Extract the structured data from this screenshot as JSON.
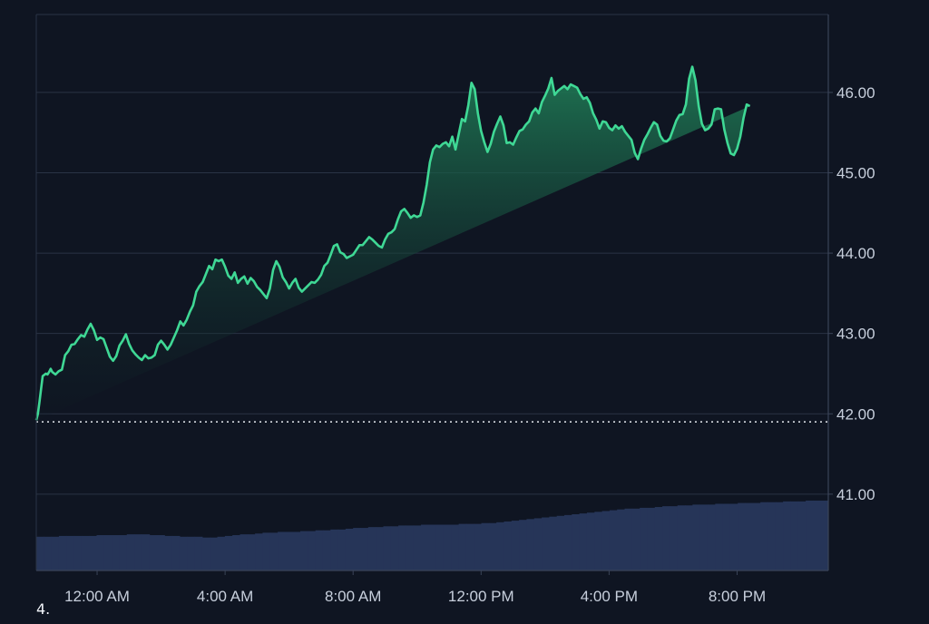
{
  "chart_data": {
    "type": "area",
    "ylim": [
      40.05,
      46.97
    ],
    "yticks": [
      "41.00",
      "42.00",
      "43.00",
      "44.00",
      "45.00",
      "46.00"
    ],
    "ytick_values": [
      41,
      42,
      43,
      44,
      45,
      46
    ],
    "xticks": [
      "12:00 AM",
      "4:00 AM",
      "8:00 AM",
      "12:00 PM",
      "4:00 PM",
      "8:00 PM"
    ],
    "xtick_hours": [
      0,
      4,
      8,
      12,
      16,
      20
    ],
    "xlim_hours": [
      -1.9,
      22.85
    ],
    "reference_line": 41.9,
    "grid": true,
    "colors": {
      "background": "#0f1522",
      "line": "#3fd895",
      "area_top": "#1f7a55",
      "area_bottom": "#0e1a22",
      "volume": "#263558",
      "grid": "#2a3345",
      "axis_text": "#c7cfdc",
      "reference": "#e6eaf0"
    },
    "price_series": {
      "hours": [
        -1.9,
        -1.85,
        -1.8,
        -1.7,
        -1.6,
        -1.55,
        -1.5,
        -1.45,
        -1.4,
        -1.3,
        -1.2,
        -1.1,
        -1.0,
        -0.9,
        -0.8,
        -0.7,
        -0.6,
        -0.5,
        -0.4,
        -0.3,
        -0.2,
        -0.1,
        0.0,
        0.1,
        0.2,
        0.3,
        0.4,
        0.5,
        0.6,
        0.7,
        0.8,
        0.9,
        1.0,
        1.1,
        1.2,
        1.3,
        1.4,
        1.5,
        1.6,
        1.7,
        1.8,
        1.9,
        2.0,
        2.1,
        2.2,
        2.3,
        2.4,
        2.5,
        2.6,
        2.7,
        2.8,
        2.9,
        3.0,
        3.1,
        3.2,
        3.3,
        3.4,
        3.5,
        3.6,
        3.7,
        3.8,
        3.9,
        4.0,
        4.1,
        4.2,
        4.3,
        4.4,
        4.5,
        4.6,
        4.7,
        4.8,
        4.9,
        5.0,
        5.1,
        5.2,
        5.3,
        5.4,
        5.5,
        5.6,
        5.7,
        5.8,
        5.9,
        6.0,
        6.1,
        6.2,
        6.3,
        6.4,
        6.5,
        6.6,
        6.7,
        6.8,
        6.9,
        7.0,
        7.1,
        7.2,
        7.3,
        7.4,
        7.5,
        7.6,
        7.7,
        7.8,
        7.9,
        8.0,
        8.1,
        8.2,
        8.3,
        8.4,
        8.5,
        8.6,
        8.7,
        8.8,
        8.9,
        9.0,
        9.1,
        9.2,
        9.3,
        9.4,
        9.5,
        9.6,
        9.7,
        9.8,
        9.9,
        10.0,
        10.1,
        10.2,
        10.3,
        10.4,
        10.5,
        10.6,
        10.7,
        10.8,
        10.9,
        11.0,
        11.1,
        11.2,
        11.3,
        11.4,
        11.5,
        11.6,
        11.7,
        11.8,
        11.9,
        12.0,
        12.1,
        12.2,
        12.3,
        12.4,
        12.5,
        12.6,
        12.7,
        12.8,
        12.9,
        13.0,
        13.1,
        13.2,
        13.3,
        13.4,
        13.5,
        13.6,
        13.7,
        13.8,
        13.9,
        14.0,
        14.1,
        14.2,
        14.3,
        14.4,
        14.5,
        14.6,
        14.7,
        14.8,
        14.9,
        15.0,
        15.1,
        15.2,
        15.3,
        15.4,
        15.5,
        15.6,
        15.7,
        15.8,
        15.9,
        16.0,
        16.1,
        16.2,
        16.3,
        16.4,
        16.5,
        16.6,
        16.7,
        16.8,
        16.9,
        17.0,
        17.1,
        17.2,
        17.3,
        17.4,
        17.5,
        17.6,
        17.7,
        17.8,
        17.9,
        18.0,
        18.1,
        18.2,
        18.3,
        18.4,
        18.5,
        18.6,
        18.7,
        18.8,
        18.9,
        19.0,
        19.1,
        19.2,
        19.3,
        19.4,
        19.5,
        19.6,
        19.7,
        19.8,
        19.9,
        20.0,
        20.1,
        20.2,
        20.3,
        20.4,
        20.5,
        20.6,
        20.7,
        20.8,
        20.9,
        21.0,
        21.1,
        21.2,
        21.3,
        21.4,
        21.5,
        21.6,
        21.7,
        21.8,
        21.9,
        22.0,
        22.1,
        22.2,
        22.3,
        22.4,
        22.5,
        22.6,
        22.7,
        22.8,
        22.85
      ],
      "values": [
        41.92,
        42.0,
        42.15,
        42.47,
        42.5,
        42.49,
        42.52,
        42.56,
        42.52,
        42.49,
        42.53,
        42.55,
        42.73,
        42.78,
        42.86,
        42.87,
        42.93,
        42.98,
        42.96,
        43.05,
        43.12,
        43.04,
        42.92,
        42.95,
        42.93,
        42.82,
        42.71,
        42.66,
        42.72,
        42.85,
        42.91,
        42.99,
        42.87,
        42.79,
        42.74,
        42.7,
        42.67,
        42.73,
        42.69,
        42.7,
        42.73,
        42.86,
        42.91,
        42.86,
        42.8,
        42.86,
        42.95,
        43.04,
        43.15,
        43.1,
        43.17,
        43.27,
        43.35,
        43.52,
        43.59,
        43.64,
        43.74,
        43.84,
        43.8,
        43.92,
        43.9,
        43.92,
        43.83,
        43.72,
        43.68,
        43.76,
        43.63,
        43.68,
        43.71,
        43.62,
        43.69,
        43.65,
        43.58,
        43.54,
        43.49,
        43.44,
        43.56,
        43.79,
        43.9,
        43.83,
        43.7,
        43.64,
        43.56,
        43.63,
        43.68,
        43.57,
        43.52,
        43.56,
        43.6,
        43.64,
        43.63,
        43.67,
        43.73,
        43.84,
        43.88,
        43.98,
        44.09,
        44.11,
        44.01,
        43.99,
        43.94,
        43.96,
        43.98,
        44.04,
        44.1,
        44.1,
        44.15,
        44.2,
        44.17,
        44.13,
        44.09,
        44.07,
        44.17,
        44.24,
        44.26,
        44.3,
        44.42,
        44.52,
        44.55,
        44.5,
        44.44,
        44.47,
        44.45,
        44.47,
        44.63,
        44.85,
        45.13,
        45.29,
        45.34,
        45.32,
        45.36,
        45.38,
        45.33,
        45.45,
        45.29,
        45.48,
        45.67,
        45.64,
        45.84,
        46.12,
        46.04,
        45.74,
        45.52,
        45.38,
        45.26,
        45.36,
        45.51,
        45.61,
        45.7,
        45.59,
        45.37,
        45.38,
        45.35,
        45.44,
        45.52,
        45.54,
        45.6,
        45.64,
        45.75,
        45.8,
        45.74,
        45.88,
        45.96,
        46.05,
        46.18,
        45.97,
        46.02,
        46.05,
        46.08,
        46.04,
        46.1,
        46.08,
        46.06,
        45.98,
        45.92,
        45.94,
        45.87,
        45.74,
        45.66,
        45.55,
        45.64,
        45.63,
        45.56,
        45.53,
        45.59,
        45.55,
        45.58,
        45.51,
        45.46,
        45.41,
        45.25,
        45.17,
        45.3,
        45.41,
        45.48,
        45.56,
        45.63,
        45.6,
        45.46,
        45.4,
        45.39,
        45.43,
        45.54,
        45.65,
        45.72,
        45.73,
        45.85,
        46.17,
        46.32,
        46.15,
        45.83,
        45.61,
        45.53,
        45.55,
        45.6,
        45.79,
        45.8,
        45.79,
        45.54,
        45.37,
        45.24,
        45.22,
        45.3,
        45.45,
        45.68,
        45.85,
        45.83
      ]
    },
    "volume_series": {
      "start_hour": -1.9,
      "end_hour": 22.85,
      "values": [
        40.47,
        40.47,
        40.47,
        40.48,
        40.48,
        40.48,
        40.48,
        40.48,
        40.49,
        40.49,
        40.49,
        40.49,
        40.5,
        40.5,
        40.5,
        40.49,
        40.49,
        40.48,
        40.48,
        40.47,
        40.47,
        40.47,
        40.46,
        40.46,
        40.47,
        40.48,
        40.49,
        40.5,
        40.5,
        40.51,
        40.52,
        40.52,
        40.53,
        40.53,
        40.53,
        40.54,
        40.54,
        40.55,
        40.55,
        40.56,
        40.56,
        40.57,
        40.58,
        40.58,
        40.59,
        40.59,
        40.6,
        40.6,
        40.61,
        40.61,
        40.61,
        40.62,
        40.62,
        40.62,
        40.62,
        40.62,
        40.63,
        40.63,
        40.63,
        40.64,
        40.64,
        40.65,
        40.66,
        40.67,
        40.68,
        40.69,
        40.7,
        40.71,
        40.72,
        40.73,
        40.74,
        40.75,
        40.76,
        40.77,
        40.78,
        40.79,
        40.8,
        40.81,
        40.82,
        40.82,
        40.83,
        40.83,
        40.84,
        40.85,
        40.85,
        40.86,
        40.86,
        40.87,
        40.87,
        40.87,
        40.88,
        40.88,
        40.88,
        40.89,
        40.89,
        40.89,
        40.9,
        40.9,
        40.9,
        40.91,
        40.91,
        40.91,
        40.92,
        40.92,
        40.92
      ]
    }
  },
  "footer": {
    "corner_text": "4."
  }
}
